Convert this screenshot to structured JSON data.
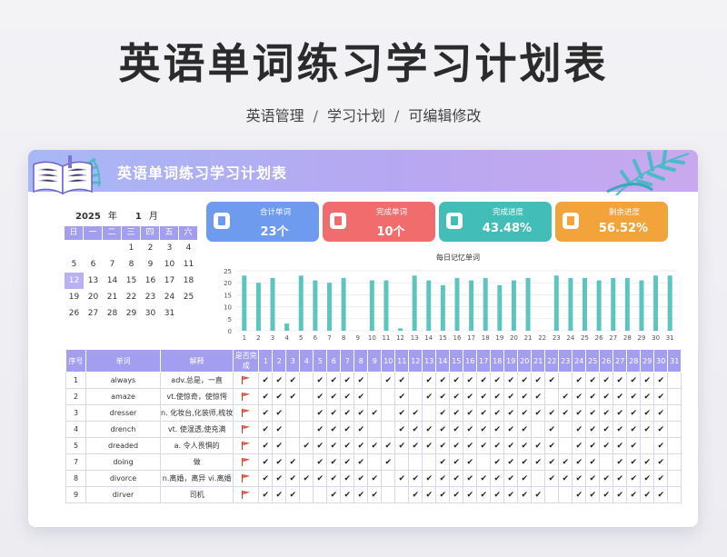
{
  "page": {
    "title": "英语单词练习学习计划表",
    "subtitle": [
      "英语管理",
      "学习计划",
      "可编辑修改"
    ],
    "separator": "/"
  },
  "sheet": {
    "banner_title": "英语单词练习学习计划表",
    "calendar": {
      "year": "2025",
      "year_unit": "年",
      "month": "1",
      "month_unit": "月",
      "weekdays": [
        "日",
        "一",
        "二",
        "三",
        "四",
        "五",
        "六"
      ],
      "days": [
        "",
        "",
        "",
        "1",
        "2",
        "3",
        "4",
        "5",
        "6",
        "7",
        "8",
        "9",
        "10",
        "11",
        "12",
        "13",
        "14",
        "15",
        "16",
        "17",
        "18",
        "19",
        "20",
        "21",
        "22",
        "23",
        "24",
        "25",
        "26",
        "27",
        "28",
        "29",
        "30",
        "31"
      ],
      "selected_day": "12"
    },
    "stats": [
      {
        "label": "合计单词",
        "value": "23个",
        "color": "#6f9bef",
        "icon": "book-icon"
      },
      {
        "label": "完成单词",
        "value": "10个",
        "color": "#f16d6d",
        "icon": "stack-icon"
      },
      {
        "label": "完成进度",
        "value": "43.48%",
        "color": "#42bdb7",
        "icon": "chart-icon"
      },
      {
        "label": "剩余进度",
        "value": "56.52%",
        "color": "#f2a33a",
        "icon": "gauge-icon"
      }
    ],
    "chart_data": {
      "type": "bar",
      "title": "每日记忆单词",
      "categories": [
        "1",
        "2",
        "3",
        "4",
        "5",
        "6",
        "7",
        "8",
        "9",
        "10",
        "11",
        "12",
        "13",
        "14",
        "15",
        "16",
        "17",
        "18",
        "19",
        "20",
        "21",
        "22",
        "23",
        "24",
        "25",
        "26",
        "27",
        "28",
        "29",
        "30",
        "31"
      ],
      "values": [
        23,
        20,
        22,
        3,
        23,
        21,
        20,
        22,
        0,
        21,
        21,
        1,
        23,
        21,
        19,
        22,
        21,
        22,
        19,
        21,
        22,
        0,
        23,
        22,
        22,
        21,
        22,
        22,
        21,
        23,
        23
      ],
      "ylim": [
        0,
        25
      ],
      "yticks": [
        0,
        5,
        10,
        15,
        20,
        25
      ],
      "bar_color": "#5cc5c0",
      "grid": true
    },
    "table": {
      "headers": {
        "idx": "序号",
        "word": "单词",
        "meaning": "解释",
        "done": "是否完成"
      },
      "days": [
        "1",
        "2",
        "3",
        "4",
        "5",
        "6",
        "7",
        "8",
        "9",
        "10",
        "11",
        "12",
        "13",
        "14",
        "15",
        "16",
        "17",
        "18",
        "19",
        "20",
        "21",
        "22",
        "23",
        "24",
        "25",
        "26",
        "27",
        "28",
        "29",
        "30",
        "31"
      ],
      "check": "✔",
      "rows": [
        {
          "idx": "1",
          "word": "always",
          "meaning": "adv.总是，一直",
          "checks": "111011110110111111111101111111"
        },
        {
          "idx": "2",
          "word": "amaze",
          "meaning": "vt.使惊奇，使惊愕",
          "checks": "111011110010111111111011111111"
        },
        {
          "idx": "3",
          "word": "dresser",
          "meaning": "n. 化妆台,化装师,梳妆",
          "checks": "110011111011011111111111111111"
        },
        {
          "idx": "4",
          "word": "drench",
          "meaning": "vt. 使湿透,使充满",
          "checks": "110011110011111111110101111111"
        },
        {
          "idx": "5",
          "word": "dreaded",
          "meaning": "a. 令人畏惧的",
          "checks": "110111111111111111111101111101"
        },
        {
          "idx": "7",
          "word": "doing",
          "meaning": "做",
          "checks": "111011110100011101111111101111"
        },
        {
          "idx": "8",
          "word": "divorce",
          "meaning": "n.离婚，离异 vi.离婚",
          "checks": "111111111011111111110111111111"
        },
        {
          "idx": "9",
          "word": "dirver",
          "meaning": "司机",
          "checks": "111001111001111111111001111111"
        }
      ]
    }
  }
}
